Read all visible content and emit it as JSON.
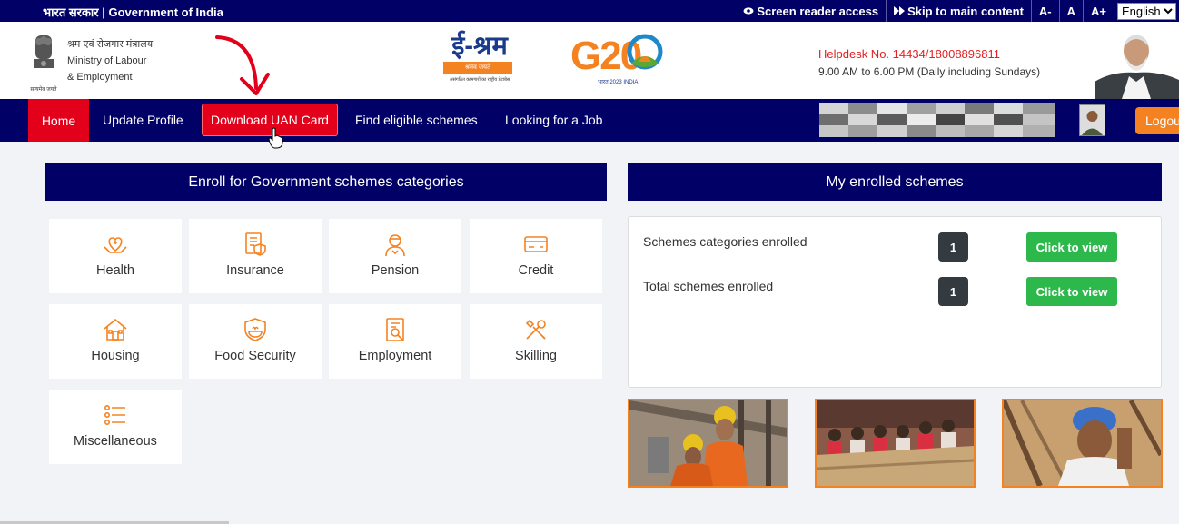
{
  "topbar": {
    "gov_text": "भारत सरकार | Government of India",
    "screen_reader": "Screen reader access",
    "skip_main": "Skip to main content",
    "font_small": "A-",
    "font_normal": "A",
    "font_large": "A+",
    "language": "English"
  },
  "header": {
    "ministry_hindi": "श्रम एवं रोजगार मंत्रालय",
    "ministry_line1": "Ministry of Labour",
    "ministry_line2": "& Employment",
    "emblem_caption": "सत्यमेव जयते",
    "eshram_title": "ई-श्रम",
    "eshram_tagline": "श्रमेव जयते",
    "eshram_sub": "असंगठित कामगारों का राष्ट्रीय डेटाबेस",
    "g20_text": "G20",
    "g20_sub": "भारत 2023 INDIA",
    "helpdesk": "Helpdesk No. 14434/18008896811",
    "timing": "9.00 AM to 6.00 PM (Daily including Sundays)"
  },
  "nav": {
    "home": "Home",
    "update_profile": "Update Profile",
    "download_uan": "Download UAN Card",
    "find_schemes": "Find eligible schemes",
    "looking_job": "Looking for a Job",
    "logout": "Logout"
  },
  "enroll": {
    "title": "Enroll for Government schemes categories",
    "categories": [
      {
        "label": "Health",
        "icon": "health-icon"
      },
      {
        "label": "Insurance",
        "icon": "insurance-icon"
      },
      {
        "label": "Pension",
        "icon": "pension-icon"
      },
      {
        "label": "Credit",
        "icon": "credit-icon"
      },
      {
        "label": "Housing",
        "icon": "housing-icon"
      },
      {
        "label": "Food Security",
        "icon": "food-security-icon"
      },
      {
        "label": "Employment",
        "icon": "employment-icon"
      },
      {
        "label": "Skilling",
        "icon": "skilling-icon"
      },
      {
        "label": "Miscellaneous",
        "icon": "miscellaneous-icon"
      }
    ]
  },
  "enrolled": {
    "title": "My enrolled schemes",
    "rows": [
      {
        "label": "Schemes categories enrolled",
        "count": "1",
        "button": "Click to view"
      },
      {
        "label": "Total schemes enrolled",
        "count": "1",
        "button": "Click to view"
      }
    ]
  },
  "colors": {
    "navy": "#000066",
    "red": "#e3001b",
    "orange": "#f58220",
    "green": "#2db84c"
  }
}
